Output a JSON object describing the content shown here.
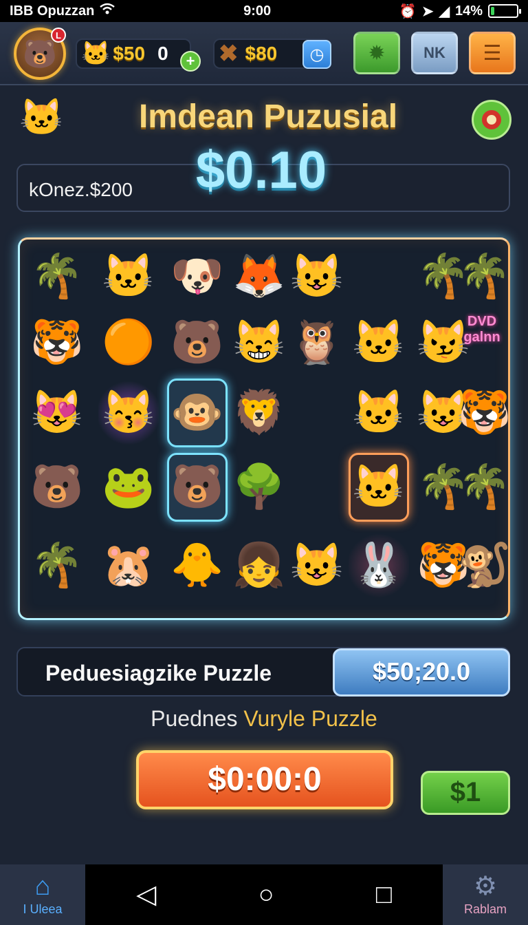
{
  "status_bar": {
    "carrier": "IBB Opuzzan",
    "time": "9:00",
    "battery": "14%",
    "battery_level": 0.14,
    "icons": [
      "wifi-icon",
      "alarm-icon",
      "location-icon",
      "signal-icon",
      "battery-icon"
    ]
  },
  "hud": {
    "avatar_badge": "L",
    "currency1": "$50",
    "currency1_count": "0",
    "currency2": "$80",
    "buttons": [
      "gear-badge-icon",
      "shield-icon",
      "menu-icon"
    ],
    "shield_label": "NK"
  },
  "header": {
    "title": "Imdean Puzusial",
    "info_label": "kOnez.$200",
    "amount": "$0.10"
  },
  "board": {
    "corner_text": "DVD galnn",
    "tiles": [
      {
        "icon": "palm-tree-icon",
        "glyph": "🌴"
      },
      {
        "icon": "orange-cat-icon",
        "glyph": "🐱"
      },
      {
        "icon": "dog-icon",
        "glyph": "🐶"
      },
      {
        "icon": "fox-icon",
        "glyph": "🦊"
      },
      {
        "icon": "blue-cat-icon",
        "glyph": "😺"
      },
      {
        "icon": "palm-tree-icon",
        "glyph": "🌴"
      },
      {
        "icon": "palm-tree-icon",
        "glyph": "🌴"
      },
      {
        "icon": "orange-cat-icon",
        "glyph": "🐯"
      },
      {
        "icon": "gold-orb-icon",
        "glyph": "🟠"
      },
      {
        "icon": "bear-icon",
        "glyph": "🐻"
      },
      {
        "icon": "purple-cat-icon",
        "glyph": "😸"
      },
      {
        "icon": "owl-cat-icon",
        "glyph": "🦉"
      },
      {
        "icon": "orange-cat-icon",
        "glyph": "🐱"
      },
      {
        "icon": "white-cat-icon",
        "glyph": "😼"
      },
      {
        "icon": "pink-cat-icon",
        "glyph": "😻"
      },
      {
        "icon": "purple-cat-icon",
        "glyph": "😽"
      },
      {
        "icon": "monkey-icon",
        "glyph": "🐵"
      },
      {
        "icon": "winged-cat-icon",
        "glyph": "🦁"
      },
      {
        "icon": "orange-cat-icon",
        "glyph": "🐱"
      },
      {
        "icon": "white-cat-icon",
        "glyph": "😺"
      },
      {
        "icon": "tiger-icon",
        "glyph": "🐯"
      },
      {
        "icon": "brown-bear-icon",
        "glyph": "🐻"
      },
      {
        "icon": "green-frog-icon",
        "glyph": "🐸"
      },
      {
        "icon": "bear-icon",
        "glyph": "🐻"
      },
      {
        "icon": "tree-icon",
        "glyph": "🌳"
      },
      {
        "icon": "white-cat-icon",
        "glyph": "🐱"
      },
      {
        "icon": "palm-tree-icon",
        "glyph": "🌴"
      },
      {
        "icon": "palm-tree-icon",
        "glyph": "🌴"
      },
      {
        "icon": "palm-tree-icon",
        "glyph": "🌴"
      },
      {
        "icon": "green-cat-icon",
        "glyph": "🐹"
      },
      {
        "icon": "yellow-cat-icon",
        "glyph": "🐥"
      },
      {
        "icon": "girl-icon",
        "glyph": "👧"
      },
      {
        "icon": "blue-cat-icon",
        "glyph": "😺"
      },
      {
        "icon": "white-cat-icon",
        "glyph": "🐰"
      },
      {
        "icon": "tiger-icon",
        "glyph": "🐯"
      },
      {
        "icon": "monkey-icon",
        "glyph": "🐒"
      }
    ]
  },
  "bottom": {
    "puzzle_label": "Peduesiagzike Puzzle",
    "price": "$50;20.0",
    "subtitle_white": "Puednes",
    "subtitle_gold": "Vuryle Puzzle",
    "play_label": "$0:00:0",
    "small_label": "$1"
  },
  "nav": {
    "left_label": "I Uleea",
    "right_label": "Rablam",
    "sys": [
      "back-icon",
      "home-icon",
      "recents-icon"
    ]
  },
  "colors": {
    "background": "#1c2433",
    "accent_gold": "#f7c62f",
    "accent_cyan": "#a9ecff",
    "play_orange": "#e5531f",
    "green": "#5fc23a"
  }
}
